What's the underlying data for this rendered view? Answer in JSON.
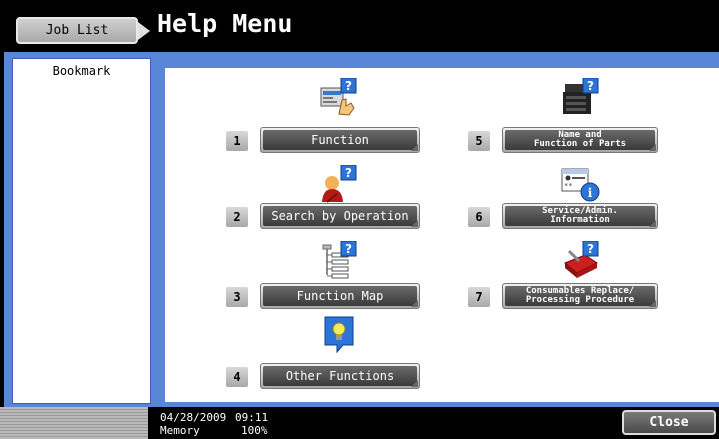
{
  "header": {
    "job_list_label": "Job List",
    "title": "Help Menu"
  },
  "sidebar": {
    "bookmark_label": "Bookmark"
  },
  "menu": {
    "items": [
      {
        "num": "1",
        "label": "Function",
        "icon": "function-icon"
      },
      {
        "num": "2",
        "label": "Search by Operation",
        "icon": "search-operation-icon"
      },
      {
        "num": "3",
        "label": "Function Map",
        "icon": "function-map-icon"
      },
      {
        "num": "4",
        "label": "Other Functions",
        "icon": "other-functions-icon"
      },
      {
        "num": "5",
        "label": "Name and\nFunction of Parts",
        "icon": "parts-icon"
      },
      {
        "num": "6",
        "label": "Service/Admin.\nInformation",
        "icon": "service-info-icon"
      },
      {
        "num": "7",
        "label": "Consumables Replace/\nProcessing Procedure",
        "icon": "consumables-icon"
      }
    ]
  },
  "status": {
    "date": "04/28/2009",
    "time": "09:11",
    "memory_label": "Memory",
    "memory_value": "100%"
  },
  "footer": {
    "close_label": "Close"
  },
  "colors": {
    "frame": "#5a86d8",
    "button_dark": "#4a4a4a",
    "help_blue": "#1a6fd0"
  }
}
